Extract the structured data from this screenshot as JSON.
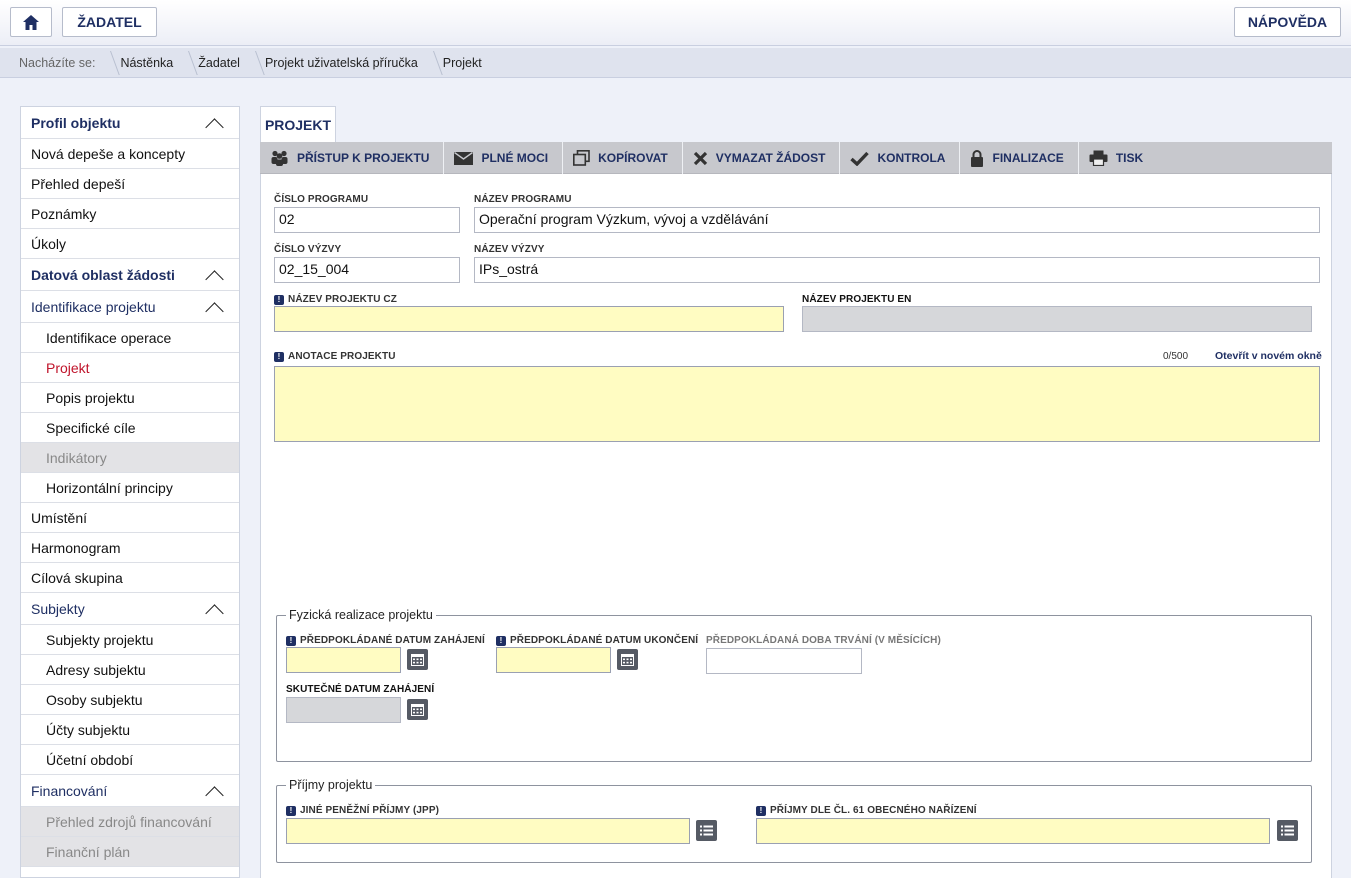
{
  "header": {
    "home_icon": "home-icon",
    "zadatel_label": "ŽADATEL",
    "napoveda_label": "NÁPOVĚDA"
  },
  "breadcrumb": {
    "prefix": "Nacházíte se:",
    "items": [
      "Nástěnka",
      "Žadatel",
      "Projekt uživatelská příručka",
      "Projekt"
    ]
  },
  "sidebar": {
    "profil": "Profil objektu",
    "nove_depese": "Nová depeše a koncepty",
    "prehled_depesi": "Přehled depeší",
    "poznamky": "Poznámky",
    "ukoly": "Úkoly",
    "datova_oblast": "Datová oblast žádosti",
    "identifikace_projektu": "Identifikace projektu",
    "identifikace_operace": "Identifikace operace",
    "projekt": "Projekt",
    "popis_projektu": "Popis projektu",
    "specificke_cile": "Specifické cíle",
    "indikatory": "Indikátory",
    "horizontalni_principy": "Horizontální principy",
    "umisteni": "Umístění",
    "harmonogram": "Harmonogram",
    "cilova_skupina": "Cílová skupina",
    "subjekty": "Subjekty",
    "subjekty_projektu": "Subjekty projektu",
    "adresy_subjektu": "Adresy subjektu",
    "osoby_subjektu": "Osoby subjektu",
    "ucty_subjektu": "Účty subjektu",
    "ucetni_obdobi": "Účetní období",
    "financovani": "Financování",
    "prehled_zdroju": "Přehled zdrojů financování",
    "financni_plan": "Finanční plán"
  },
  "tab": {
    "label": "PROJEKT"
  },
  "toolbar": {
    "pristup": "PŘÍSTUP K PROJEKTU",
    "plne_moci": "PLNÉ MOCI",
    "kopirovat": "KOPÍROVAT",
    "vymazat": "VYMAZAT ŽÁDOST",
    "kontrola": "KONTROLA",
    "finalizace": "FINALIZACE",
    "tisk": "TISK"
  },
  "form": {
    "cislo_programu_label": "ČÍSLO PROGRAMU",
    "cislo_programu_value": "02",
    "nazev_programu_label": "NÁZEV PROGRAMU",
    "nazev_programu_value": "Operační program Výzkum, vývoj a vzdělávání",
    "cislo_vyzvy_label": "ČÍSLO VÝZVY",
    "cislo_vyzvy_value": "02_15_004",
    "nazev_vyzvy_label": "NÁZEV VÝZVY",
    "nazev_vyzvy_value": "IPs_ostrá",
    "nazev_cz_label": "NÁZEV PROJEKTU CZ",
    "nazev_en_label": "NÁZEV PROJEKTU EN",
    "anotace_label": "ANOTACE PROJEKTU",
    "anotace_counter": "0/500",
    "anotace_link": "Otevřít v novém okně",
    "fyzicka_legend": "Fyzická realizace projektu",
    "datum_zahajeni_label": "PŘEDPOKLÁDANÉ DATUM ZAHÁJENÍ",
    "datum_ukonceni_label": "PŘEDPOKLÁDANÉ DATUM UKONČENÍ",
    "doba_trvani_label": "PŘEDPOKLÁDANÁ DOBA TRVÁNÍ (V MĚSÍCÍCH)",
    "skutecne_zahajeni_label": "SKUTEČNÉ DATUM ZAHÁJENÍ",
    "prijmy_legend": "Příjmy projektu",
    "jpp_label": "JINÉ PENĚŽNÍ PŘÍJMY (JPP)",
    "cl61_label": "PŘÍJMY DLE ČL. 61 OBECNÉHO NAŘÍZENÍ"
  }
}
